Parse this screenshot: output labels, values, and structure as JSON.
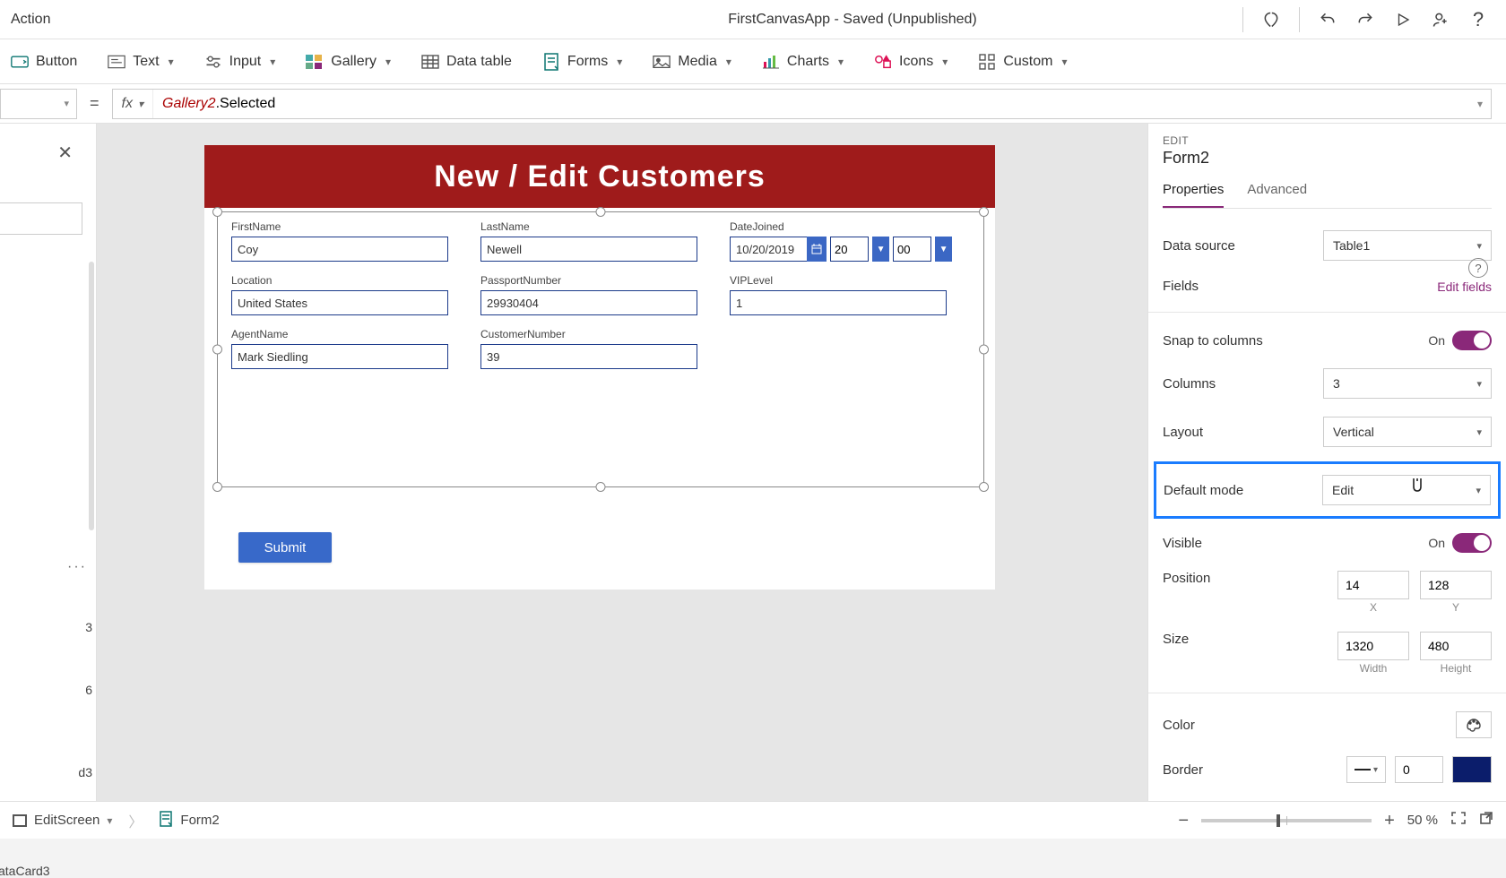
{
  "header": {
    "menu_action": "Action",
    "title": "FirstCanvasApp - Saved (Unpublished)"
  },
  "ribbon": {
    "button": "Button",
    "text": "Text",
    "input": "Input",
    "gallery": "Gallery",
    "data_table": "Data table",
    "forms": "Forms",
    "media": "Media",
    "charts": "Charts",
    "icons": "Icons",
    "custom": "Custom"
  },
  "formula": {
    "fx": "fx",
    "expr_prefix": "Gallery2",
    "expr_suffix": ".Selected"
  },
  "tree": {
    "row1": "3",
    "row2": "6",
    "row3": "d3",
    "row4": "ataCard3"
  },
  "canvas": {
    "page_title": "New / Edit Customers",
    "fields": {
      "first_name_label": "FirstName",
      "first_name_value": "Coy",
      "last_name_label": "LastName",
      "last_name_value": "Newell",
      "date_joined_label": "DateJoined",
      "date_joined_value": "10/20/2019",
      "hour": "20",
      "minute": "00",
      "location_label": "Location",
      "location_value": "United States",
      "passport_label": "PassportNumber",
      "passport_value": "29930404",
      "vip_label": "VIPLevel",
      "vip_value": "1",
      "agent_label": "AgentName",
      "agent_value": "Mark Siedling",
      "custno_label": "CustomerNumber",
      "custno_value": "39"
    },
    "submit": "Submit"
  },
  "panel": {
    "kicker": "EDIT",
    "title": "Form2",
    "tab_properties": "Properties",
    "tab_advanced": "Advanced",
    "data_source_label": "Data source",
    "data_source_value": "Table1",
    "fields_label": "Fields",
    "edit_fields": "Edit fields",
    "snap_label": "Snap to columns",
    "snap_state": "On",
    "columns_label": "Columns",
    "columns_value": "3",
    "layout_label": "Layout",
    "layout_value": "Vertical",
    "default_mode_label": "Default mode",
    "default_mode_value": "Edit",
    "visible_label": "Visible",
    "visible_state": "On",
    "position_label": "Position",
    "pos_x": "14",
    "pos_y": "128",
    "x_label": "X",
    "y_label": "Y",
    "size_label": "Size",
    "width": "1320",
    "height": "480",
    "width_label": "Width",
    "height_label": "Height",
    "color_label": "Color",
    "border_label": "Border",
    "border_value": "0"
  },
  "status": {
    "screen": "EditScreen",
    "form": "Form2",
    "zoom": "50  %"
  }
}
